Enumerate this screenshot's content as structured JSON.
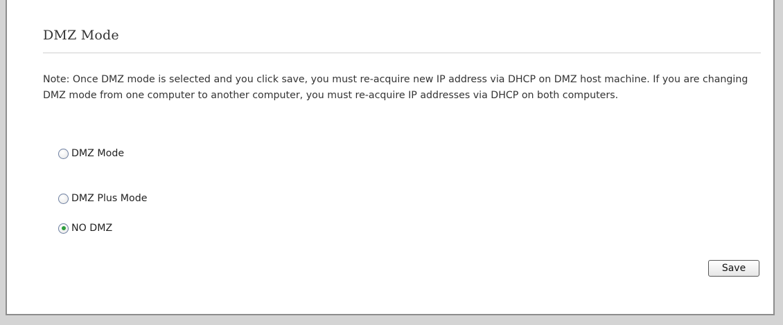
{
  "section": {
    "title": "DMZ Mode",
    "note": "Note: Once DMZ mode is selected and you click save, you must re-acquire new IP address via DHCP on DMZ host machine. If you are changing DMZ mode from one computer to another computer, you must re-acquire IP addresses via DHCP on both computers."
  },
  "options": [
    {
      "label": "DMZ Mode",
      "checked": false
    },
    {
      "label": "DMZ Plus Mode",
      "checked": false
    },
    {
      "label": "NO DMZ",
      "checked": true
    }
  ],
  "actions": {
    "save_label": "Save"
  },
  "colors": {
    "radio_selected": "#2e9e3e"
  }
}
